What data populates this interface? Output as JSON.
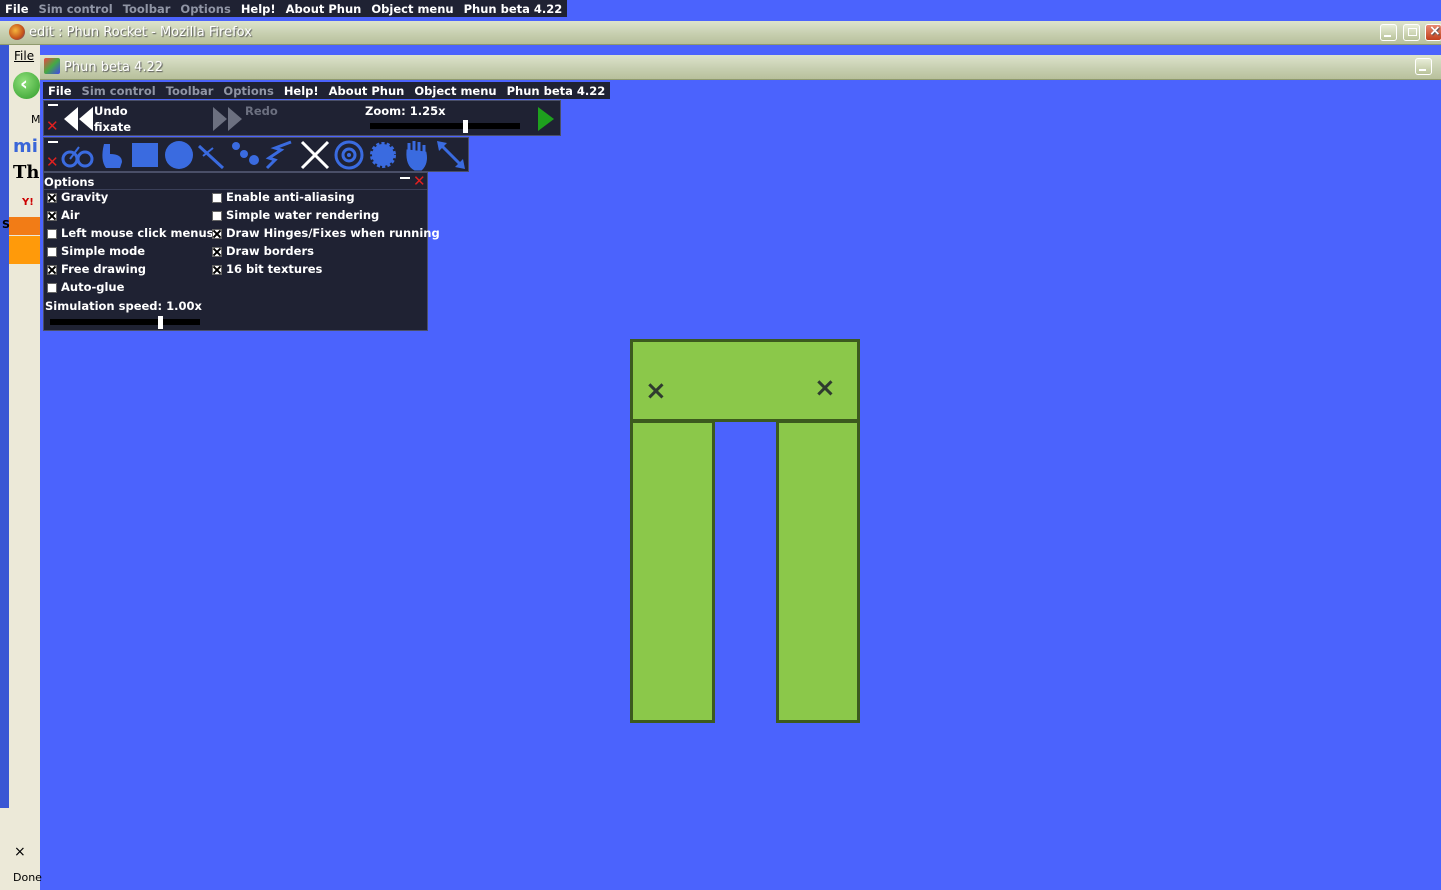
{
  "top_menu": {
    "items": [
      {
        "label": "File",
        "dim": false
      },
      {
        "label": "Sim control",
        "dim": true
      },
      {
        "label": "Toolbar",
        "dim": true
      },
      {
        "label": "Options",
        "dim": true
      },
      {
        "label": "Help!",
        "dim": false
      },
      {
        "label": "About Phun",
        "dim": false
      },
      {
        "label": "Object menu",
        "dim": false
      },
      {
        "label": "Phun beta 4.22",
        "dim": false
      }
    ]
  },
  "firefox": {
    "title": "edit : Phun Rocket - Mozilla Firefox",
    "file_menu": "File",
    "status": "Done",
    "tab_close": "×",
    "partial_items": [
      "M",
      "mi",
      "Th",
      "S"
    ]
  },
  "phun_window": {
    "title": "Phun beta 4.22"
  },
  "inner_menu": {
    "items": [
      {
        "label": "File",
        "dim": false
      },
      {
        "label": "Sim control",
        "dim": true
      },
      {
        "label": "Toolbar",
        "dim": true
      },
      {
        "label": "Options",
        "dim": true
      },
      {
        "label": "Help!",
        "dim": false
      },
      {
        "label": "About Phun",
        "dim": false
      },
      {
        "label": "Object menu",
        "dim": false
      },
      {
        "label": "Phun beta 4.22",
        "dim": false
      }
    ]
  },
  "sim_control": {
    "undo_label": "Undo",
    "undo_action": "fixate",
    "redo_label": "Redo",
    "zoom_label": "Zoom: 1.25x",
    "zoom_value": 1.25
  },
  "toolbar": {
    "tools": [
      "drag-tool-icon",
      "bike-tool-icon",
      "brush-tool-icon",
      "box-tool-icon",
      "circle-tool-icon",
      "plane-tool-icon",
      "chain-tool-icon",
      "spring-tool-icon",
      "fixate-tool-icon",
      "hinge-tool-icon",
      "gear-tool-icon",
      "hand-tool-icon",
      "move-tool-icon"
    ]
  },
  "options": {
    "title": "Options",
    "left": [
      {
        "label": "Gravity",
        "checked": true
      },
      {
        "label": "Air",
        "checked": true
      },
      {
        "label": "Left mouse click menus",
        "checked": false
      },
      {
        "label": "Simple mode",
        "checked": false
      },
      {
        "label": "Free drawing",
        "checked": true
      },
      {
        "label": "Auto-glue",
        "checked": false
      }
    ],
    "right": [
      {
        "label": "Enable anti-aliasing",
        "checked": false
      },
      {
        "label": "Simple water rendering",
        "checked": false
      },
      {
        "label": "Draw Hinges/Fixes when running",
        "checked": true
      },
      {
        "label": "Draw borders",
        "checked": true
      },
      {
        "label": "16 bit textures",
        "checked": true
      }
    ],
    "sim_speed_label": "Simulation speed: 1.00x",
    "sim_speed_value": 1.0
  },
  "colors": {
    "canvas_bg": "#4b63fd",
    "panel_bg": "#1f2233",
    "object_fill": "#8bc84a",
    "object_border": "#3c5a1e",
    "play_green": "#1ea01e"
  }
}
